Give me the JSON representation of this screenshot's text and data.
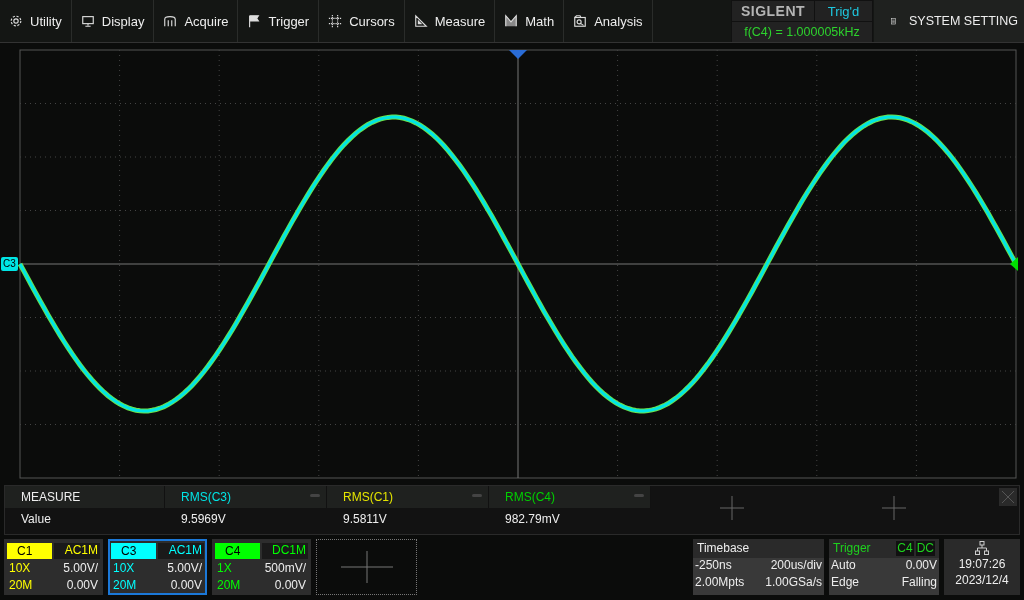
{
  "menu": [
    {
      "label": "Utility"
    },
    {
      "label": "Display"
    },
    {
      "label": "Acquire"
    },
    {
      "label": "Trigger"
    },
    {
      "label": "Cursors"
    },
    {
      "label": "Measure"
    },
    {
      "label": "Math"
    },
    {
      "label": "Analysis"
    }
  ],
  "brand": {
    "logo": "SIGLENT",
    "trigger_status": "Trig'd",
    "frequency": "f(C4) = 1.000005kHz"
  },
  "system_button": {
    "label": "SYSTEM SETTING"
  },
  "screen": {
    "channel_marker": "C3"
  },
  "measure": {
    "title": "MEASURE",
    "row_label": "Value",
    "items": [
      {
        "name": "RMS(C3)",
        "value": "9.5969V",
        "color": "#00e5e5"
      },
      {
        "name": "RMS(C1)",
        "value": "9.5811V",
        "color": "#e5e500"
      },
      {
        "name": "RMS(C4)",
        "value": "982.79mV",
        "color": "#00d000"
      }
    ]
  },
  "channels": [
    {
      "name": "C1",
      "coupling": "AC1M",
      "probe": "10X",
      "scale": "5.00V/",
      "bandwidth": "20M",
      "offset": "0.00V",
      "color": "#ffff00",
      "selected": false
    },
    {
      "name": "C3",
      "coupling": "AC1M",
      "probe": "10X",
      "scale": "5.00V/",
      "bandwidth": "20M",
      "offset": "0.00V",
      "color": "#00ffff",
      "selected": true
    },
    {
      "name": "C4",
      "coupling": "DC1M",
      "probe": "1X",
      "scale": "500mV/",
      "bandwidth": "20M",
      "offset": "0.00V",
      "color": "#00ff00",
      "selected": false
    }
  ],
  "timebase": {
    "title": "Timebase",
    "delay": "-250ns",
    "scale": "200us/div",
    "memory": "2.00Mpts",
    "sample_rate": "1.00GSa/s"
  },
  "trigger": {
    "title": "Trigger",
    "source": "C4",
    "coupling": "DC",
    "mode": "Auto",
    "level": "0.00V",
    "type": "Edge",
    "slope": "Falling"
  },
  "clock": {
    "time": "19:07:26",
    "date": "2023/12/4"
  }
}
